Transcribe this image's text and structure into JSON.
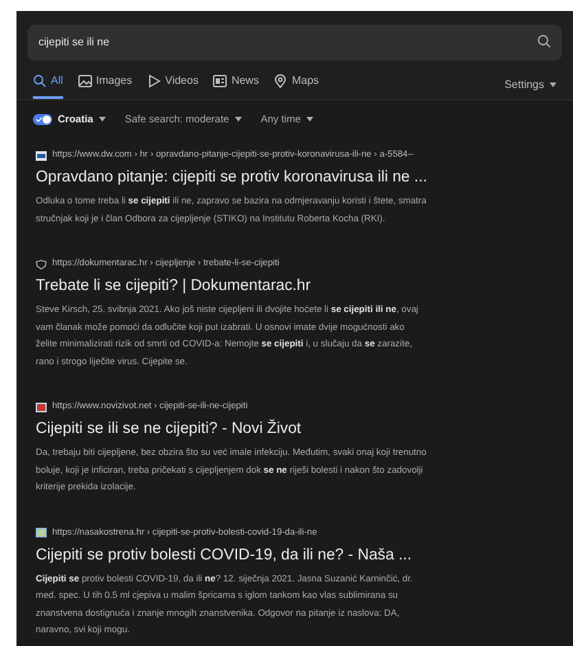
{
  "search": {
    "query": "cijepiti se ili ne"
  },
  "tabs": [
    {
      "label": "All",
      "selected": true
    },
    {
      "label": "Images",
      "selected": false
    },
    {
      "label": "Videos",
      "selected": false
    },
    {
      "label": "News",
      "selected": false
    },
    {
      "label": "Maps",
      "selected": false
    }
  ],
  "settings": {
    "label": "Settings"
  },
  "filters": {
    "region": {
      "label": "Croatia",
      "on": true
    },
    "safe_search": {
      "label": "Safe search: moderate"
    },
    "time": {
      "label": "Any time"
    }
  },
  "results": [
    {
      "url": "https://www.dw.com › hr › opravdano-pitanje-cijepiti-se-protiv-koronavirusa-ili-ne › a-5584--",
      "title": "Opravdano pitanje: cijepiti se protiv koronavirusa ili ne ...",
      "snippet": "Odluka o tome treba li **se cijepiti** ili ne, zapravo se bazira na odmjeravanju koristi i štete, smatra stručnjak koji je i član Odbora za cijepljenje (STIKO) na Institutu Roberta Kocha (RKI)."
    },
    {
      "url": "https://dokumentarac.hr › cijepljenje › trebate-li-se-cijepiti",
      "title": "Trebate li se cijepiti? | Dokumentarac.hr",
      "snippet": "Steve Kirsch, 25. svibnja 2021. Ako još niste cijepljeni ili dvojite hoćete li **se cijepiti ili ne**, ovaj vam članak može pomoći da odlučite koji put izabrati. U osnovi imate dvije mogućnosti ako želite minimalizirati rizik od smrti od COVID-a: Nemojte **se cijepiti** i, u slučaju da **se** zarazite, rano i strogo liječite virus. Cijepite se."
    },
    {
      "url": "https://www.novizivot.net › cijepiti-se-ili-ne-cijepiti",
      "title": "Cijepiti se ili se ne cijepiti? - Novi Život",
      "snippet": "Da, trebaju biti cijepljene, bez obzira što su već imale infekciju. Međutim, svaki onaj koji trenutno boluje, koji je inficiran, treba pričekati s cijepljenjem dok **se ne** riješi bolesti i nakon što zadovolji kriterije prekida izolacije."
    },
    {
      "url": "https://nasakostrena.hr › cijepiti-se-protiv-bolesti-covid-19-da-ili-ne",
      "title": "Cijepiti se protiv bolesti COVID-19, da ili ne? - Naša ...",
      "snippet": "**Cijepiti se** protiv bolesti COVID-19, da ili **ne**? 12. siječnja 2021. Jasna Suzanić Karninčić, dr. med. spec. U tih 0.5 ml cjepiva u malim špricama s iglom tankom kao vlas sublimirana su znanstvena dostignuća i znanje mnogih znanstvenika. Odgovor na pitanje iz naslova: DA, naravno, svi koji mogu."
    }
  ]
}
